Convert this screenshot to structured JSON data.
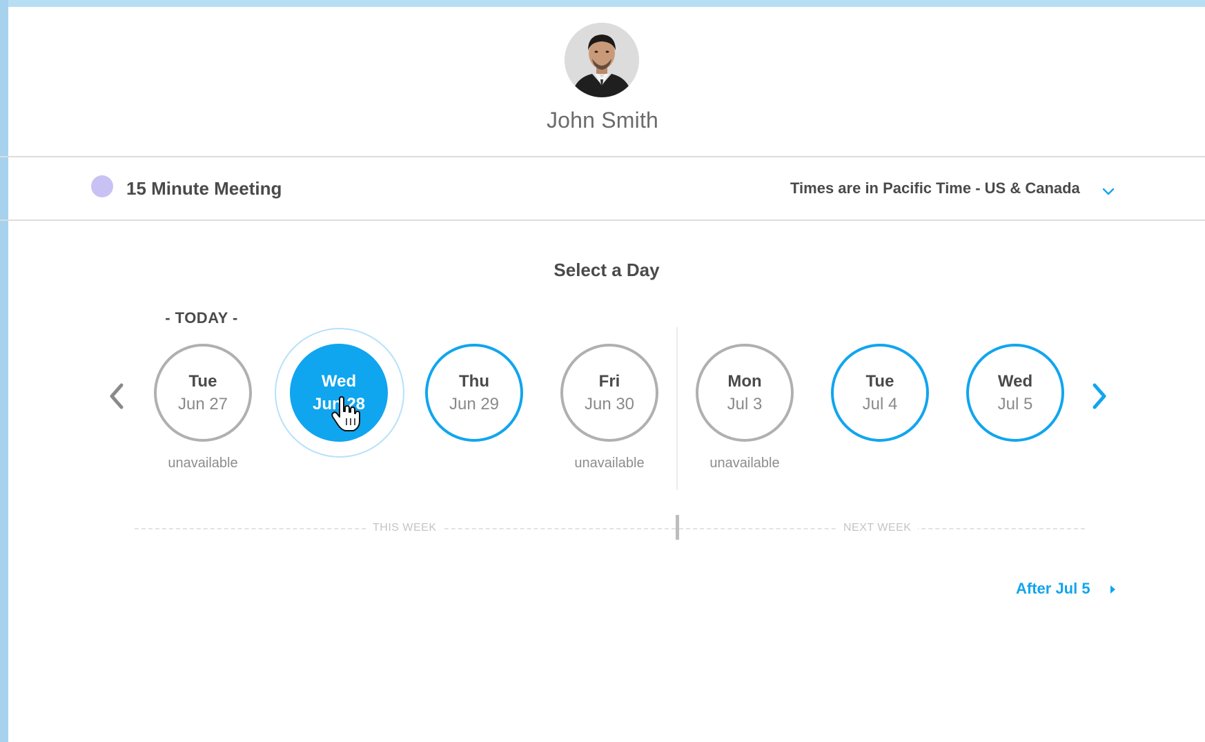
{
  "owner": {
    "name": "John Smith"
  },
  "event": {
    "name": "15 Minute Meeting",
    "color": "#c8c2f4"
  },
  "timezone": {
    "label": "Times are in Pacific Time - US & Canada"
  },
  "calendar": {
    "title": "Select a Day",
    "today_label": "- TODAY -",
    "days": [
      {
        "day": "Tue",
        "date": "Jun 27",
        "status": "unavailable"
      },
      {
        "day": "Wed",
        "date": "Jun 28",
        "status": "selected"
      },
      {
        "day": "Thu",
        "date": "Jun 29",
        "status": "available"
      },
      {
        "day": "Fri",
        "date": "Jun 30",
        "status": "unavailable"
      },
      {
        "day": "Mon",
        "date": "Jul 3",
        "status": "unavailable"
      },
      {
        "day": "Tue",
        "date": "Jul 4",
        "status": "available"
      },
      {
        "day": "Wed",
        "date": "Jul 5",
        "status": "available"
      }
    ],
    "unavailable_text": "unavailable",
    "week_labels": {
      "this_week": "THIS WEEK",
      "next_week": "NEXT WEEK"
    },
    "after_link": "After Jul 5"
  },
  "icons": {
    "prev": "chevron-left-icon",
    "next": "chevron-right-icon",
    "timezone_toggle": "chevron-down-icon",
    "after": "caret-right-icon",
    "cursor": "hand-pointer-icon"
  },
  "colors": {
    "accent": "#10a5ef",
    "unavailable_border": "#b0b0b0",
    "background_frame": "#a9d6f2"
  }
}
